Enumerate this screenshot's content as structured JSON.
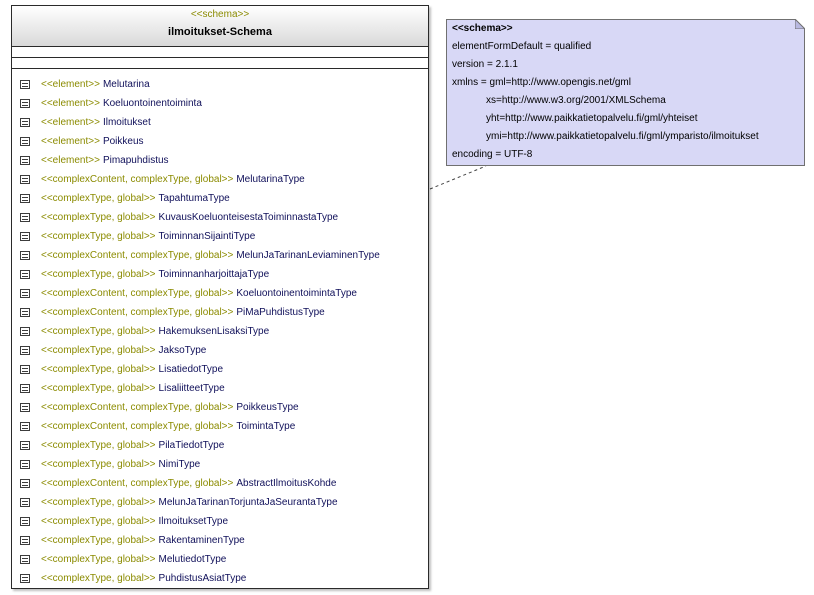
{
  "class": {
    "stereotype": "<<schema>>",
    "title": "ilmoitukset-Schema",
    "operations": [
      {
        "stereo": "<<element>>",
        "name": "Melutarina"
      },
      {
        "stereo": "<<element>>",
        "name": "Koeluontoinentoiminta"
      },
      {
        "stereo": "<<element>>",
        "name": "Ilmoitukset"
      },
      {
        "stereo": "<<element>>",
        "name": "Poikkeus"
      },
      {
        "stereo": "<<element>>",
        "name": "Pimapuhdistus"
      },
      {
        "stereo": "<<complexContent, complexType, global>>",
        "name": "MelutarinaType"
      },
      {
        "stereo": "<<complexType, global>>",
        "name": "TapahtumaType"
      },
      {
        "stereo": "<<complexType, global>>",
        "name": "KuvausKoeluonteisestaToiminnastaType"
      },
      {
        "stereo": "<<complexType, global>>",
        "name": "ToiminnanSijaintiType"
      },
      {
        "stereo": "<<complexContent, complexType, global>>",
        "name": "MelunJaTarinanLeviaminenType"
      },
      {
        "stereo": "<<complexType, global>>",
        "name": "ToiminnanharjoittajaType"
      },
      {
        "stereo": "<<complexContent, complexType, global>>",
        "name": "KoeluontoinentoimintaType"
      },
      {
        "stereo": "<<complexContent, complexType, global>>",
        "name": "PiMaPuhdistusType"
      },
      {
        "stereo": "<<complexType, global>>",
        "name": "HakemuksenLisaksiType"
      },
      {
        "stereo": "<<complexType, global>>",
        "name": "JaksoType"
      },
      {
        "stereo": "<<complexType, global>>",
        "name": "LisatiedotType"
      },
      {
        "stereo": "<<complexType, global>>",
        "name": "LisaliitteetType"
      },
      {
        "stereo": "<<complexContent, complexType, global>>",
        "name": "PoikkeusType"
      },
      {
        "stereo": "<<complexContent, complexType, global>>",
        "name": "ToimintaType"
      },
      {
        "stereo": "<<complexType, global>>",
        "name": "PilaTiedotType"
      },
      {
        "stereo": "<<complexType, global>>",
        "name": "NimiType"
      },
      {
        "stereo": "<<complexContent, complexType, global>>",
        "name": "AbstractIlmoitusKohde"
      },
      {
        "stereo": "<<complexType, global>>",
        "name": "MelunJaTarinanTorjuntaJaSeurantaType"
      },
      {
        "stereo": "<<complexType, global>>",
        "name": "IlmoituksetType"
      },
      {
        "stereo": "<<complexType, global>>",
        "name": "RakentaminenType"
      },
      {
        "stereo": "<<complexType, global>>",
        "name": "MelutiedotType"
      },
      {
        "stereo": "<<complexType, global>>",
        "name": "PuhdistusAsiatType"
      }
    ]
  },
  "note": {
    "title": "<<schema>>",
    "lines": [
      "elementFormDefault = qualified",
      "version = 2.1.1",
      "xmlns = gml=http://www.opengis.net/gml",
      "xs=http://www.w3.org/2001/XMLSchema",
      "yht=http://www.paikkatietopalvelu.fi/gml/yhteiset",
      "ymi=http://www.paikkatietopalvelu.fi/gml/ymparisto/ilmoitukset",
      "encoding = UTF-8"
    ]
  },
  "colors": {
    "stereotype": "#8b8b00",
    "operation_name": "#10105a",
    "note_fill": "#d8d8f6",
    "header_gradient_end": "#d9d9d9"
  }
}
